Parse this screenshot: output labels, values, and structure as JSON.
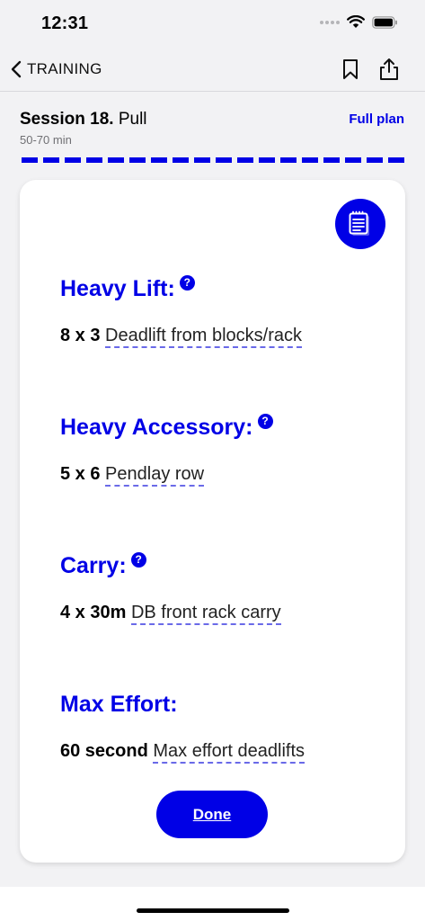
{
  "status_bar": {
    "time": "12:31"
  },
  "nav": {
    "back_label": "TRAINING",
    "icons": [
      "bookmark-icon",
      "share-icon"
    ]
  },
  "session": {
    "title_bold": "Session 18.",
    "title_rest": " Pull",
    "duration": "50-70 min",
    "full_plan_label": "Full plan"
  },
  "progress": {
    "segments": 18,
    "completed": 18
  },
  "sections": [
    {
      "title": "Heavy Lift:",
      "has_help": true,
      "quantity": "8 x 3",
      "exercise": "Deadlift from blocks/rack"
    },
    {
      "title": "Heavy Accessory:",
      "has_help": true,
      "quantity": "5 x 6",
      "exercise": "Pendlay row"
    },
    {
      "title": "Carry:",
      "has_help": true,
      "quantity": "4 x 30m",
      "exercise": "DB front rack carry"
    },
    {
      "title": "Max Effort:",
      "has_help": false,
      "quantity": "60 second",
      "exercise": "Max effort deadlifts"
    }
  ],
  "help_glyph": "?",
  "done_label": "Done",
  "colors": {
    "accent": "#0000e6",
    "background": "#f2f2f4",
    "card": "#ffffff"
  }
}
